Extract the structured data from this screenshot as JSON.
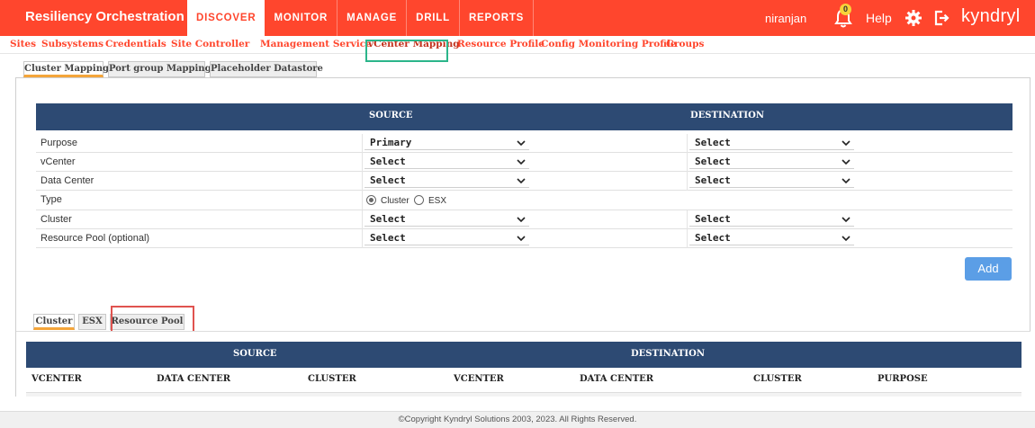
{
  "app": {
    "brand": "Resiliency Orchestration",
    "user": "niranjan",
    "notification_count": "0",
    "help": "Help",
    "logo": "kyndryl"
  },
  "main_nav": [
    "DISCOVER",
    "MONITOR",
    "MANAGE",
    "DRILL",
    "REPORTS"
  ],
  "sub_nav": [
    "Sites",
    "Subsystems",
    "Credentials",
    "Site Controller",
    "Management Service",
    "vCenter Mapping",
    "Resource Profile",
    "Config Monitoring Profile",
    "Groups"
  ],
  "mapping_tabs": [
    "Cluster Mapping",
    "Port group Mapping",
    "Placeholder Datastore"
  ],
  "form": {
    "source_header": "SOURCE",
    "destination_header": "DESTINATION",
    "rows": [
      {
        "label": "Purpose",
        "source": "Primary",
        "destination": "Select"
      },
      {
        "label": "vCenter",
        "source": "Select",
        "destination": "Select"
      },
      {
        "label": "Data Center",
        "source": "Select",
        "destination": "Select"
      },
      {
        "label": "Type"
      },
      {
        "label": "Cluster",
        "source": "Select",
        "destination": "Select"
      },
      {
        "label": "Resource Pool (optional)",
        "source": "Select",
        "destination": "Select"
      }
    ],
    "type_options": [
      "Cluster",
      "ESX"
    ],
    "type_selected": "Cluster",
    "add_label": "Add"
  },
  "result_tabs": [
    "Cluster",
    "ESX",
    "Resource Pool"
  ],
  "result_table": {
    "source_header": "SOURCE",
    "destination_header": "DESTINATION",
    "columns": [
      "VCENTER",
      "DATA CENTER",
      "CLUSTER",
      "VCENTER",
      "DATA CENTER",
      "CLUSTER",
      "PURPOSE"
    ]
  },
  "footer": "©Copyright Kyndryl Solutions 2003, 2023. All Rights Reserved.",
  "colors": {
    "brand_red": "#FF462D",
    "header_navy": "#2D4A73",
    "add_blue": "#5B9EE6",
    "highlight_green": "#2BB58A",
    "highlight_red": "#E0534F"
  }
}
